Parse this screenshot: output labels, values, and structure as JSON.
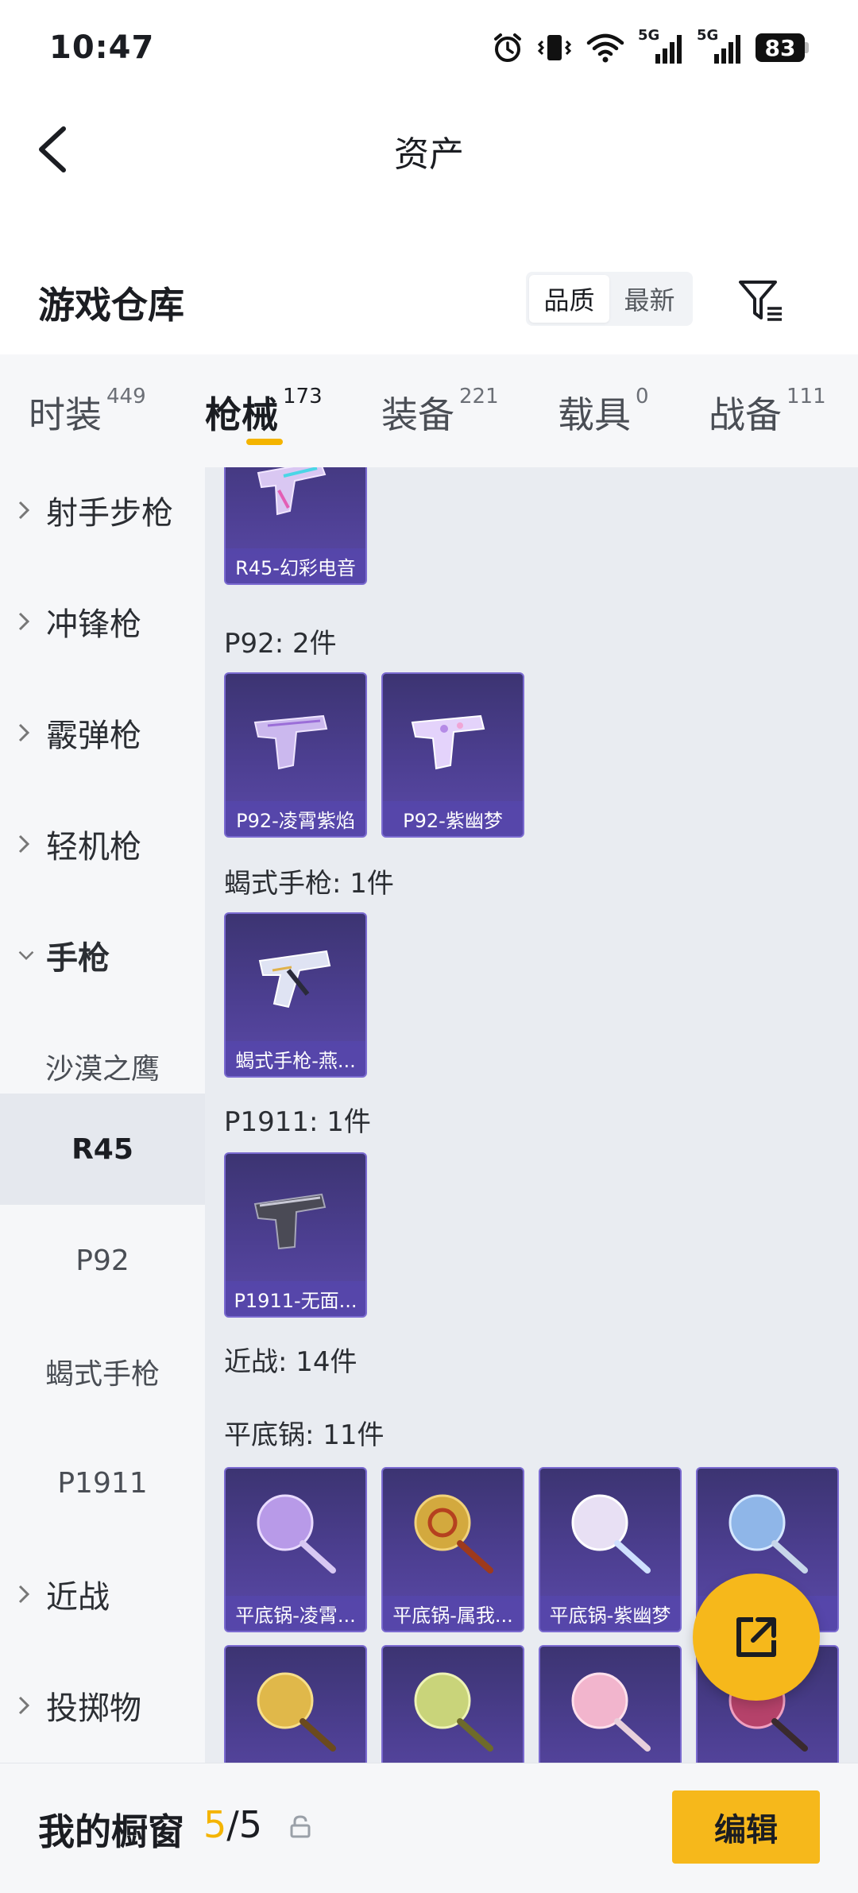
{
  "status": {
    "time": "10:47",
    "battery": "83",
    "net1": "5G",
    "net2": "5G"
  },
  "header": {
    "title": "资产"
  },
  "warehouse": {
    "title": "游戏仓库",
    "sort_options": [
      "品质",
      "最新"
    ],
    "sort_active": 0
  },
  "tabs": [
    {
      "label": "时装",
      "count": "449"
    },
    {
      "label": "枪械",
      "count": "173"
    },
    {
      "label": "装备",
      "count": "221"
    },
    {
      "label": "载具",
      "count": "0"
    },
    {
      "label": "战备",
      "count": "111"
    }
  ],
  "sidebar": {
    "groups": [
      "射手步枪",
      "冲锋枪",
      "霰弹枪",
      "轻机枪",
      "手枪"
    ],
    "subitems": [
      "沙漠之鹰",
      "R45",
      "P92",
      "蝎式手枪",
      "P1911"
    ],
    "after": [
      "近战",
      "投掷物"
    ]
  },
  "main": {
    "sections": {
      "p92": "P92: 2件",
      "scorpion": "蝎式手枪: 1件",
      "p1911": "P1911: 1件",
      "melee": "近战: 14件",
      "pan": "平底锅: 11件"
    },
    "items": {
      "r45_1": "R45-幻彩电音",
      "p92_1": "P92-凌霄紫焰",
      "p92_2": "P92-紫幽梦",
      "scorpion_1": "蝎式手枪-燕...",
      "p1911_1": "P1911-无面...",
      "pan_1": "平底锅-凌霄...",
      "pan_2": "平底锅-属我...",
      "pan_3": "平底锅-紫幽梦"
    }
  },
  "bottom": {
    "label": "我的橱窗",
    "current": "5",
    "total": "/5",
    "edit": "编辑"
  },
  "colors": {
    "accent": "#f6b81b",
    "card": "#4d3f92"
  }
}
